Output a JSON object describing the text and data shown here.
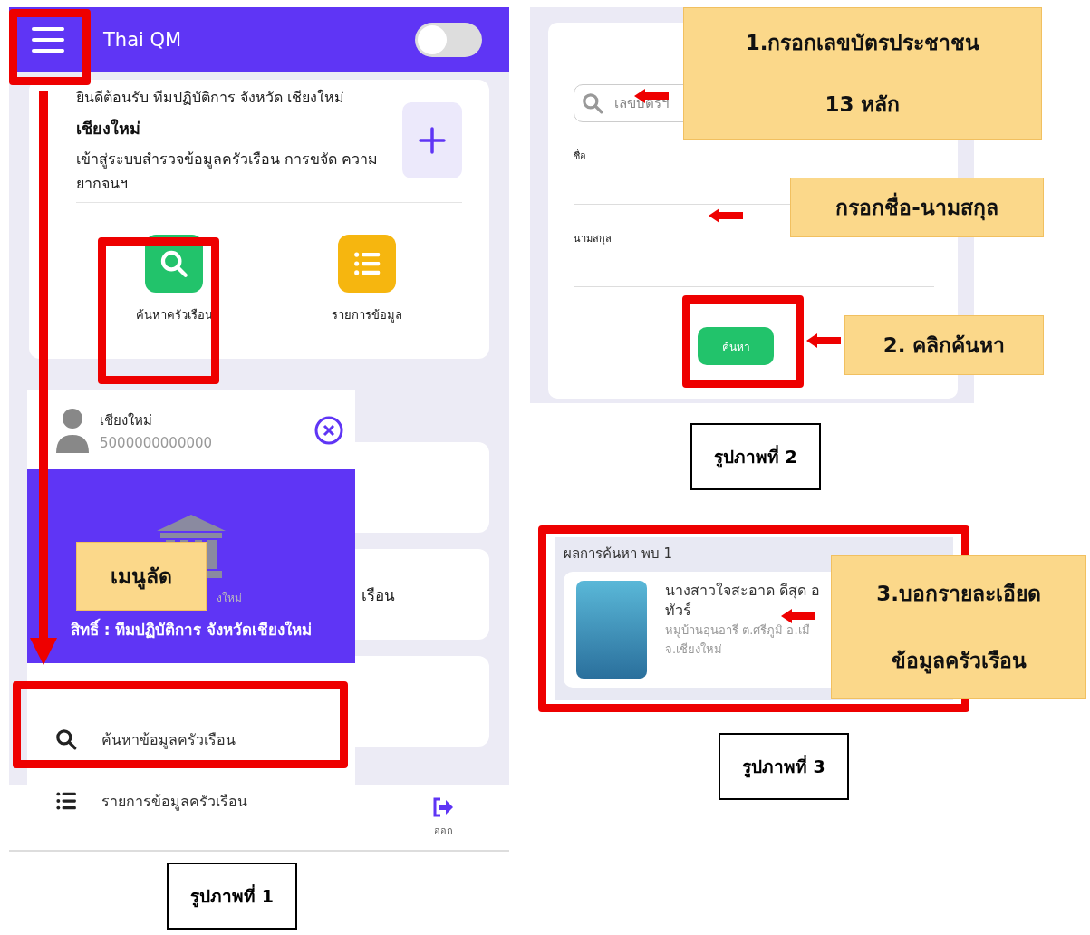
{
  "figure_1": {
    "app_bar": {
      "title": "Thai QM",
      "toggle_on": false
    },
    "welcome": {
      "greeting": "ยินดีต้อนรับ ทีมปฏิบัติการ จังหวัด เชียงใหม่",
      "heading": "เชียงใหม่",
      "description": "เข้าสู่ระบบสำรวจข้อมูลครัวเรือน การขจัด ความยากจนฯ"
    },
    "shortcuts": [
      {
        "kind": "search",
        "label": "ค้นหาครัวเรือน",
        "color": "#22c36b"
      },
      {
        "kind": "list",
        "label": "รายการข้อมูล",
        "color": "#f6b60f"
      }
    ],
    "background_card_text": "เรือน",
    "drawer": {
      "user_name": "เชียงใหม่",
      "user_id": "5000000000000",
      "banner_partial": "งใหม่",
      "banner_role": "สิทธิ์ : ทีมปฏิบัติการ จังหวัดเชียงใหม่",
      "menu": [
        {
          "kind": "search",
          "label": "ค้นหาข้อมูลครัวเรือน"
        },
        {
          "kind": "list",
          "label": "รายการข้อมูลครัวเรือน"
        }
      ]
    },
    "bottom_nav_exit": "ออก",
    "caption": "รูปภาพที่ 1"
  },
  "figure_2": {
    "id_placeholder": "เลขบัตรฯ",
    "first_name_label": "ชื่อ",
    "last_name_label": "นามสกุล",
    "search_button": "ค้นหา",
    "caption": "รูปภาพที่ 2"
  },
  "figure_3": {
    "result_title": "ผลการค้นหา พบ 1",
    "name": "นางสาวใจสะอาด ดีสุด อ",
    "name_line2": "ทัวร์",
    "address": "หมู่บ้านอุ่นอารี ต.ศรีภูมิ อ.เมื",
    "address_line2": "จ.เชียงใหม่",
    "caption": "รูปภาพที่ 3"
  },
  "callouts": [
    {
      "kind": "id",
      "lines": [
        "1.กรอกเลขบัตรประชาชน",
        "13 หลัก"
      ]
    },
    {
      "kind": "name",
      "lines": [
        "กรอกชื่อ-นามสกุล"
      ]
    },
    {
      "kind": "click",
      "lines": [
        "2. คลิกค้นหา"
      ]
    },
    {
      "kind": "result",
      "lines": [
        "3.บอกรายละเอียด",
        "ข้อมูลครัวเรือน"
      ]
    },
    {
      "kind": "menu",
      "lines": [
        "เมนูลัด"
      ]
    }
  ]
}
